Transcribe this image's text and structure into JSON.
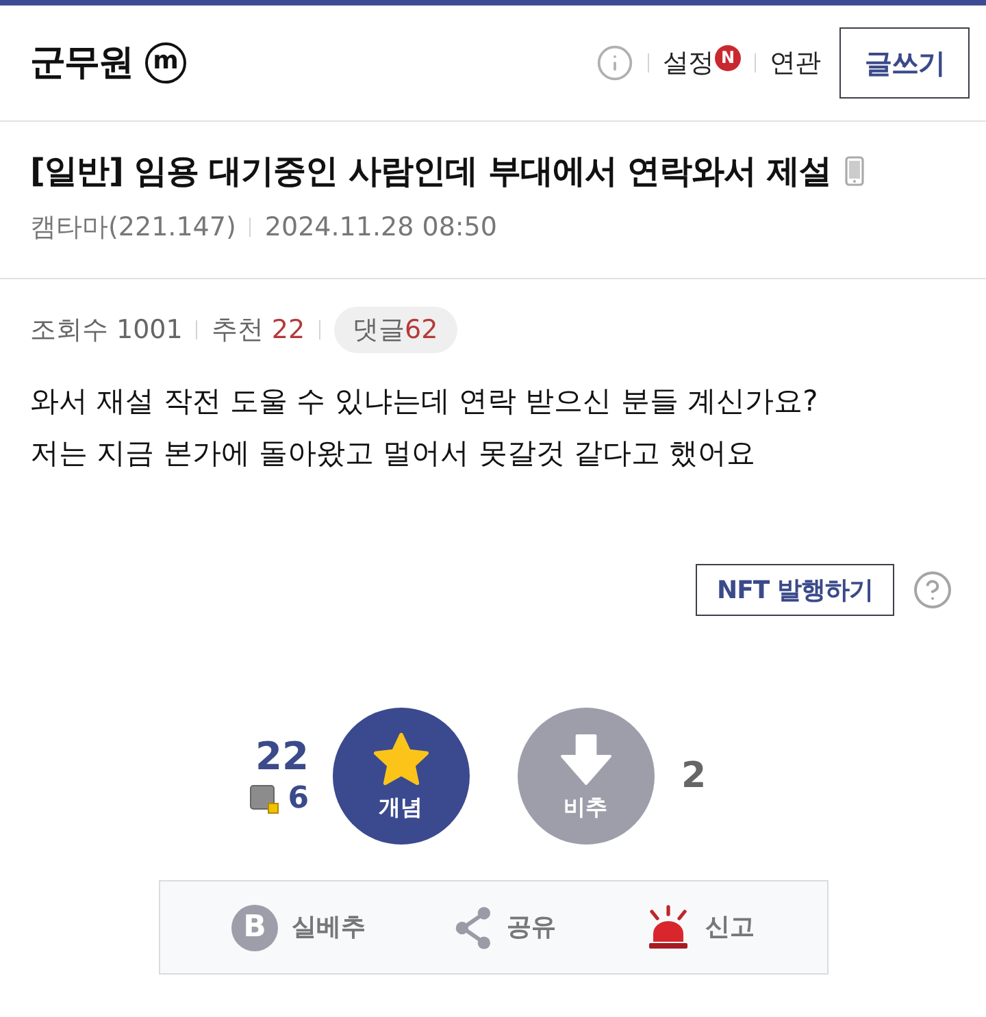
{
  "header": {
    "logo": "군무원",
    "logo_mark": "m",
    "menu": [
      {
        "label": "설정",
        "badge": "N"
      },
      {
        "label": "연관"
      }
    ],
    "write_button": "글쓰기"
  },
  "post": {
    "title": "[일반] 임용 대기중인 사람인데 부대에서 연락와서 제설",
    "author": "캠타마(221.147)",
    "date": "2024.11.28 08:50",
    "stats": [
      {
        "label": "조회수",
        "value": "1001",
        "highlight": false
      },
      {
        "label": "추천",
        "value": "22",
        "highlight": true
      }
    ],
    "comments": {
      "label": "댓글",
      "value": "62"
    },
    "body": [
      "와서 재설 작전 도울 수 있냐는데 연락 받으신 분들 계신가요?",
      "저는 지금 본가에 돌아왔고 멀어서 못갈것 같다고 했어요"
    ]
  },
  "nft_button": "NFT 발행하기",
  "votes": {
    "up": {
      "count": "22",
      "sub_count": "6",
      "label": "개념"
    },
    "down": {
      "label": "비추",
      "count": "2"
    }
  },
  "actions": [
    {
      "kind": "best",
      "icon_letter": "B",
      "label": "실베추"
    },
    {
      "kind": "share",
      "label": "공유"
    },
    {
      "kind": "report",
      "label": "신고"
    }
  ]
}
